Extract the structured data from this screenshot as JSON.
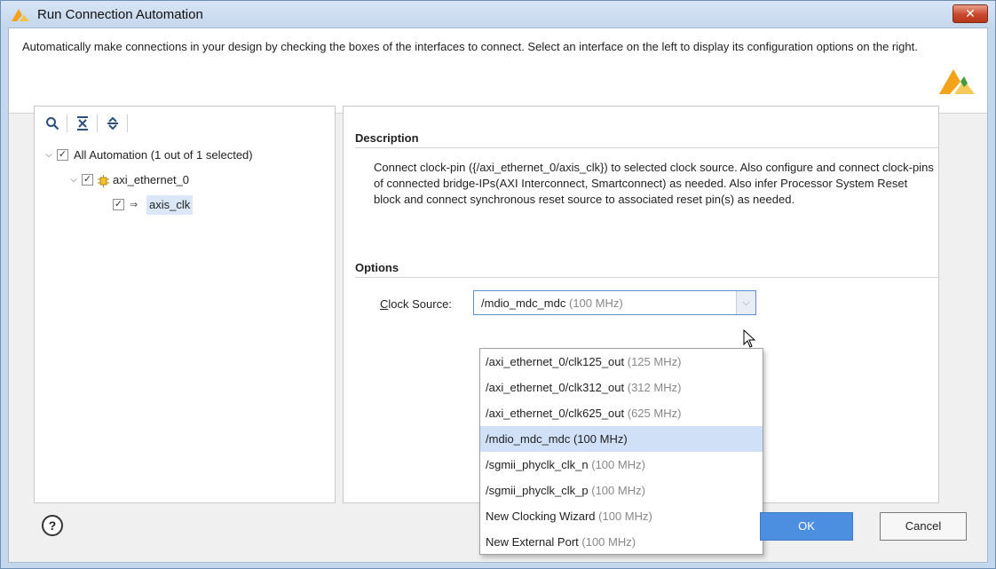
{
  "window": {
    "title": "Run Connection Automation",
    "close_glyph": "✕",
    "colors": {
      "titlebar": "#c5d7ec",
      "logo": "#f4a21a",
      "accent": "#4c8fe0",
      "selection": "#cfe0f7"
    }
  },
  "header": {
    "text": "Automatically make connections in your design by checking the boxes of the interfaces to connect. Select an interface on the left to display its configuration options on the right."
  },
  "tree": {
    "toolbar": {
      "search_icon": "search-icon",
      "collapse_icon": "collapse-all-icon",
      "expand_icon": "expand-all-icon"
    },
    "items": [
      {
        "label": "All Automation (1 out of 1 selected)",
        "checked": true,
        "expanded": true
      },
      {
        "label": "axi_ethernet_0",
        "checked": true,
        "expanded": true,
        "icon": "ip-block-icon"
      },
      {
        "label": "axis_clk",
        "checked": true,
        "selected": true,
        "icon": "clock-pin-icon"
      }
    ]
  },
  "details": {
    "description_title": "Description",
    "description": "Connect clock-pin ({/axi_ethernet_0/axis_clk}) to selected clock source. Also configure and connect clock-pins of connected bridge-IPs(AXI Interconnect, Smartconnect) as needed. Also infer Processor System Reset block and connect synchronous reset source to associated reset pin(s) as needed.",
    "options_title": "Options",
    "clock_source_label_access": "C",
    "clock_source_label_rest": "lock Source:",
    "clock_source_value": "/mdio_mdc_mdc",
    "clock_source_freq": "(100 MHz)",
    "options": [
      {
        "name": "/axi_ethernet_0/clk125_out",
        "freq": "(125 MHz)"
      },
      {
        "name": "/axi_ethernet_0/clk312_out",
        "freq": "(312 MHz)"
      },
      {
        "name": "/axi_ethernet_0/clk625_out",
        "freq": "(625 MHz)"
      },
      {
        "name": "/mdio_mdc_mdc",
        "freq": "(100 MHz)",
        "selected": true
      },
      {
        "name": "/sgmii_phyclk_clk_n",
        "freq": "(100 MHz)"
      },
      {
        "name": "/sgmii_phyclk_clk_p",
        "freq": "(100 MHz)"
      },
      {
        "name": "New Clocking Wizard",
        "freq": "(100 MHz)"
      },
      {
        "name": "New External Port",
        "freq": "(100 MHz)"
      }
    ]
  },
  "footer": {
    "help": "?",
    "ok": "OK",
    "cancel": "Cancel"
  }
}
